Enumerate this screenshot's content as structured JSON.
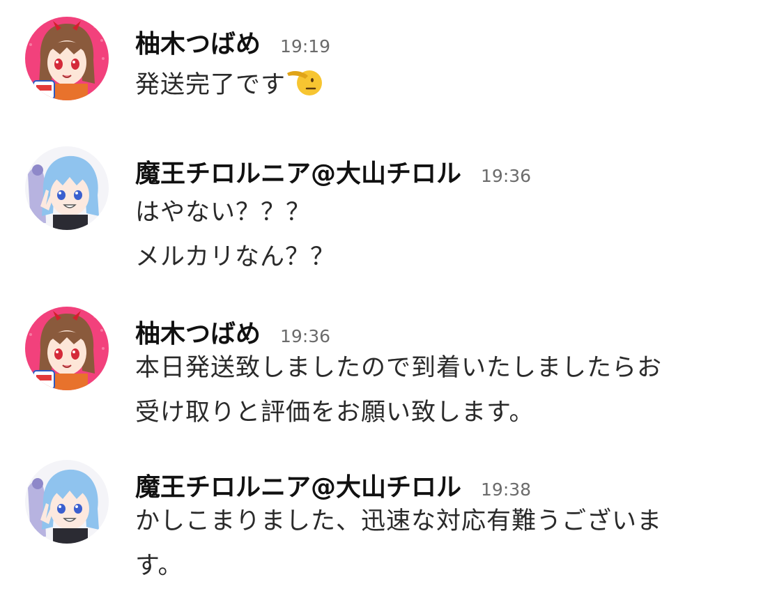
{
  "messages": [
    {
      "author": "柚木つばめ",
      "time": "19:19",
      "lines": [
        "発送完了です"
      ],
      "emoji": "saluting-face-emoji",
      "avatar": "tsubame-avatar"
    },
    {
      "author": "魔王チロルニア@大山チロル",
      "time": "19:36",
      "lines": [
        "はやない？？？",
        "メルカリなん？？"
      ],
      "avatar": "tirol-avatar"
    },
    {
      "author": "柚木つばめ",
      "time": "19:36",
      "lines": [
        "本日発送致しましたので到着いたしましたらお",
        "受け取りと評価をお願い致します。"
      ],
      "avatar": "tsubame-avatar"
    },
    {
      "author": "魔王チロルニア@大山チロル",
      "time": "19:38",
      "lines": [
        "かしこまりました、迅速な対応有難うございま",
        "す。"
      ],
      "avatar": "tirol-avatar"
    }
  ],
  "colors": {
    "tsubame_avatar_bg": "#f2417c",
    "tsubame_hair": "#8a5a3c",
    "tirol_avatar_bg": "#f4f4f8",
    "tirol_hair": "#8fc3ee",
    "timestamp": "#6b6b6b",
    "emoji_yellow": "#f7c531"
  }
}
